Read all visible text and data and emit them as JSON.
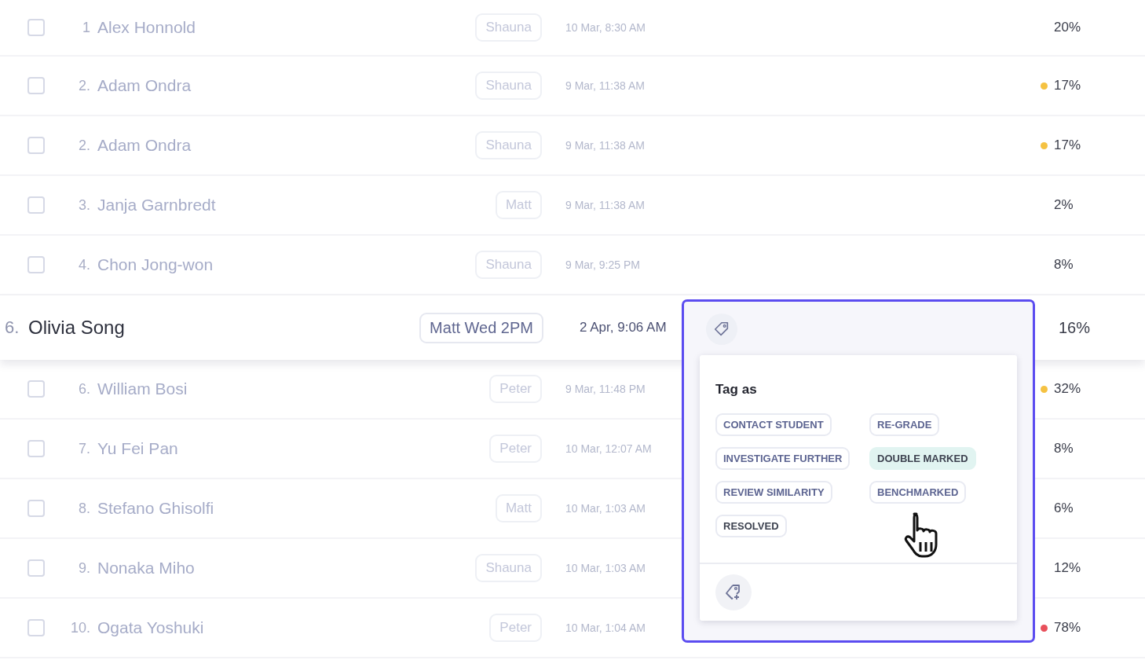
{
  "rows_above": [
    {
      "number": "1",
      "name": "Alex Honnold",
      "tutor": "Shauna",
      "date": "10 Mar, 8:30 AM",
      "score": "20%",
      "checked": false
    },
    {
      "number": "2.",
      "name": "Adam Ondra",
      "tutor": "Shauna",
      "date": "9 Mar, 11:38 AM",
      "score": "17%",
      "checked": false,
      "color": "#f5c242"
    },
    {
      "number": "2.",
      "name": "Adam Ondra",
      "tutor": "Shauna",
      "date": "9 Mar, 11:38 AM",
      "score": "17%",
      "checked": false,
      "color": "#f5c242"
    },
    {
      "number": "3.",
      "name": "Janja Garnbredt",
      "tutor": "Matt",
      "date": "9 Mar, 11:38 AM",
      "score": "2%",
      "checked": false
    },
    {
      "number": "4.",
      "name": "Chon Jong-won",
      "tutor": "Shauna",
      "date": "9 Mar, 9:25 PM",
      "score": "8%",
      "checked": false
    }
  ],
  "focused_row": {
    "number": "6.",
    "name": "Olivia Song",
    "tutor": "Matt Wed 2PM",
    "date": "2 Apr, 9:06 AM",
    "score": "16%"
  },
  "rows_below": [
    {
      "number": "6.",
      "name": "William Bosi",
      "tutor": "Peter",
      "date": "9 Mar, 11:48 PM",
      "score": "32%",
      "checked": false,
      "color": "#f5c242"
    },
    {
      "number": "7.",
      "name": "Yu Fei Pan",
      "tutor": "Peter",
      "date": "10 Mar, 12:07 AM",
      "score": "8%",
      "checked": false
    },
    {
      "number": "8.",
      "name": "Stefano Ghisolfi",
      "tutor": "Matt",
      "date": "10 Mar, 1:03 AM",
      "score": "6%",
      "checked": false
    },
    {
      "number": "9.",
      "name": "Nonaka Miho",
      "tutor": "Shauna",
      "date": "10 Mar, 1:03 AM",
      "score": "12%",
      "checked": false
    },
    {
      "number": "10.",
      "name": "Ogata Yoshuki",
      "tutor": "Peter",
      "date": "10 Mar, 1:04 AM",
      "score": "78%",
      "checked": false,
      "color": "#e8505b"
    }
  ],
  "tag_menu": {
    "title": "Tag as",
    "tags": [
      {
        "label": "CONTACT STUDENT",
        "selected": false
      },
      {
        "label": "RE-GRADE",
        "selected": false
      },
      {
        "label": "INVESTIGATE FURTHER",
        "selected": false
      },
      {
        "label": "DOUBLE MARKED",
        "selected": true
      },
      {
        "label": "REVIEW SIMILARITY",
        "selected": false
      },
      {
        "label": "BENCHMARKED",
        "selected": false
      },
      {
        "label": "RESOLVED",
        "selected": false
      }
    ]
  }
}
